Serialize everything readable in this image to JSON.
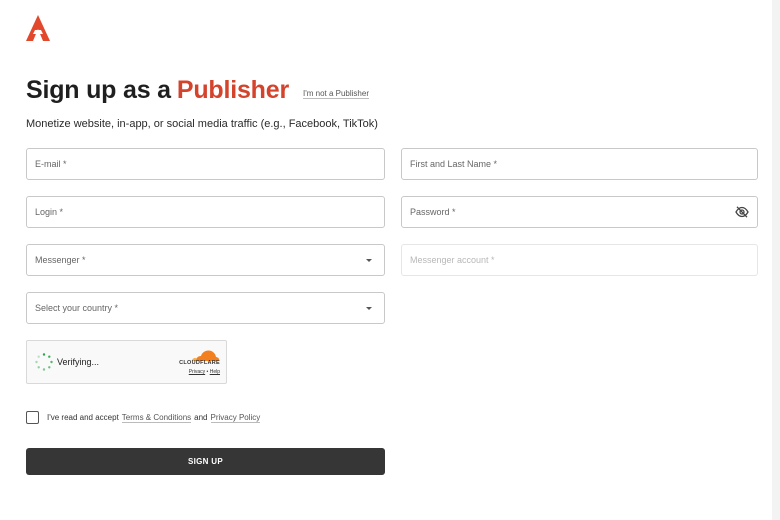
{
  "header": {
    "title": "Sign up as a",
    "title_accent": "Publisher",
    "not_publisher_link": "I'm not a Publisher",
    "subtitle": "Monetize website, in-app, or social media traffic (e.g., Facebook, TikTok)",
    "brand_color": "#d4432c"
  },
  "form": {
    "email_placeholder": "E-mail *",
    "name_placeholder": "First and Last Name *",
    "login_placeholder": "Login *",
    "password_placeholder": "Password *",
    "messenger_placeholder": "Messenger *",
    "messenger_account_placeholder": "Messenger account *",
    "country_placeholder": "Select your country *"
  },
  "captcha": {
    "status": "Verifying...",
    "provider": "CLOUDFLARE",
    "privacy": "Privacy",
    "separator": "•",
    "help": "Help"
  },
  "terms": {
    "prefix": "I've read and accept",
    "terms_link": "Terms & Conditions",
    "and": "and",
    "privacy_link": "Privacy Policy"
  },
  "submit_label": "SIGN UP"
}
